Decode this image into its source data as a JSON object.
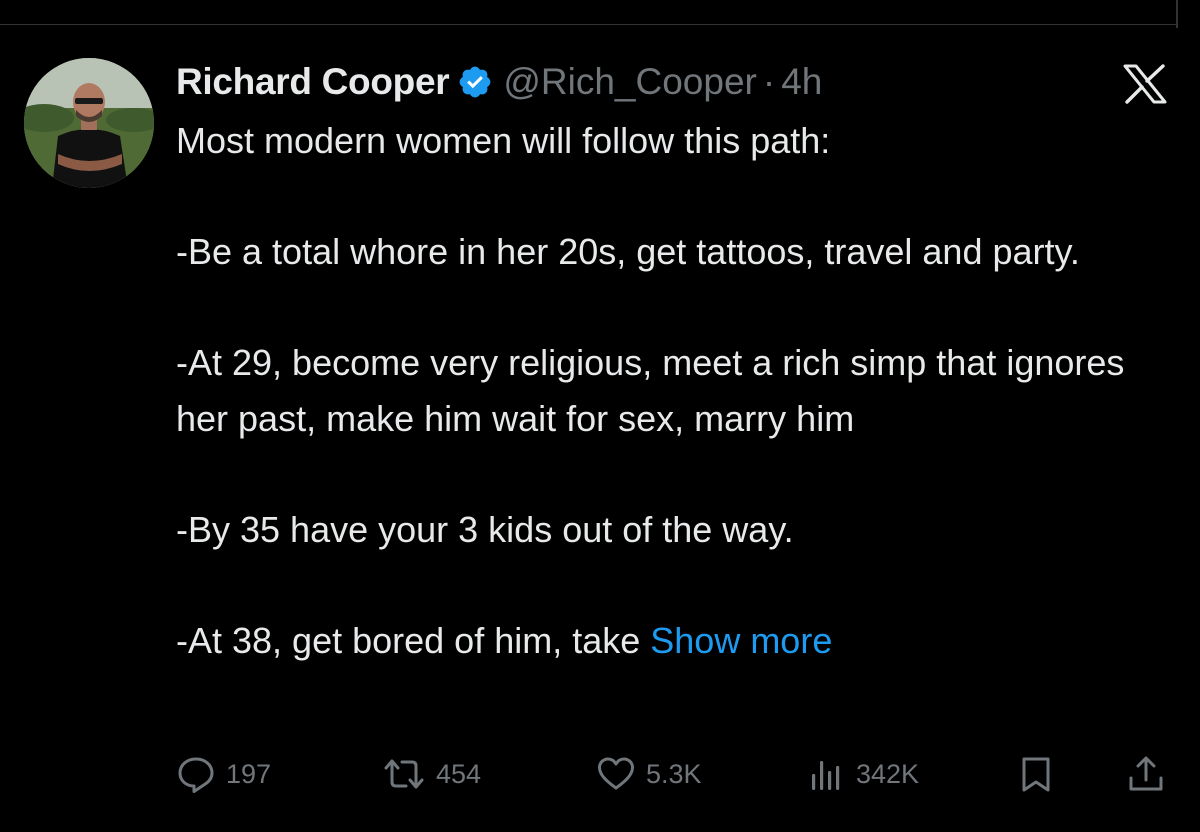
{
  "tweet": {
    "author": {
      "display_name": "Richard Cooper",
      "handle": "@Rich_Cooper",
      "verified": true
    },
    "separator": "·",
    "timestamp": "4h",
    "paragraphs": [
      "Most modern women will follow this path:",
      "-Be a total whore in her 20s, get tattoos, travel and party.",
      "-At 29, become very religious, meet a rich simp that ignores her past, make him wait for sex, marry him",
      "-By 35 have your 3 kids out of the way."
    ],
    "truncated_line": "-At 38, get bored of him, take ",
    "show_more_label": "Show more",
    "metrics": {
      "replies": "197",
      "reposts": "454",
      "likes": "5.3K",
      "views": "342K"
    }
  },
  "icons": {
    "verified": "verified-badge-icon",
    "x_logo": "x-logo-icon",
    "reply": "reply-icon",
    "repost": "repost-icon",
    "like": "heart-icon",
    "views": "views-icon",
    "bookmark": "bookmark-icon",
    "share": "share-icon"
  },
  "colors": {
    "background": "#000000",
    "text_primary": "#e7e9ea",
    "text_secondary": "#71767b",
    "accent": "#1d9bf0",
    "divider": "#2f3336"
  }
}
